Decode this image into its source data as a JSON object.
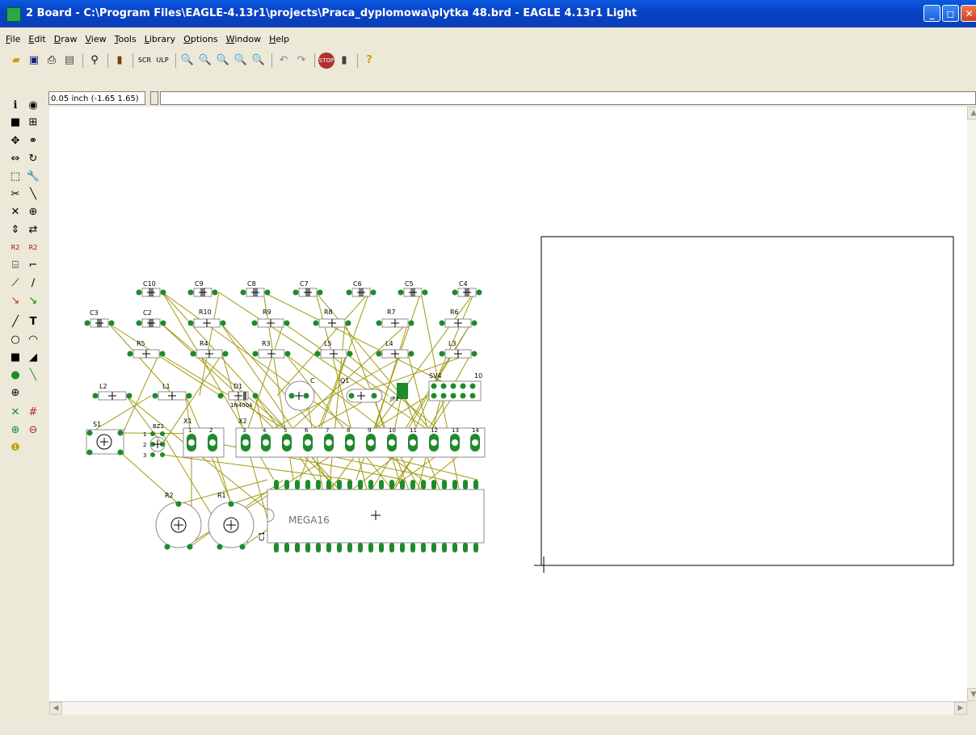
{
  "window": {
    "title": "2 Board - C:\\Program Files\\EAGLE-4.13r1\\projects\\Praca_dyplomowa\\plytka 48.brd - EAGLE 4.13r1 Light",
    "minimize": "_",
    "maximize": "◻",
    "close": "✕"
  },
  "menu": [
    "File",
    "Edit",
    "Draw",
    "View",
    "Tools",
    "Library",
    "Options",
    "Window",
    "Help"
  ],
  "toolbar": {
    "icons": [
      "open-icon",
      "save-icon",
      "print-icon",
      "cam-icon",
      "board-icon",
      "library-icon",
      "script-icon",
      "ulp-icon",
      "zoom-fit-icon",
      "zoom-in-icon",
      "zoom-out-icon",
      "zoom-redraw-icon",
      "zoom-select-icon",
      "undo-icon",
      "redo-icon",
      "stop-icon",
      "go-icon",
      "help-icon"
    ]
  },
  "coordinates": "0.05 inch (-1.65 1.65)",
  "command_value": "",
  "board": {
    "parts": [
      "C10",
      "C9",
      "C8",
      "C7",
      "C6",
      "C5",
      "C4",
      "C3",
      "C2",
      "R10",
      "R9",
      "R8",
      "R7",
      "R6",
      "R5",
      "R4",
      "R3",
      "L5",
      "L4",
      "L3",
      "L2",
      "L1",
      "D1",
      "C",
      "Q1",
      "JP1",
      "SV4",
      "10",
      "S1",
      "BZ1",
      "X1",
      "X2",
      "R2",
      "R1",
      "C1",
      "MEGA16"
    ],
    "d1_value": "1N4004",
    "bz_pins": [
      "1",
      "2",
      "3"
    ],
    "x_pins": [
      "1",
      "2",
      "3",
      "4",
      "5",
      "6",
      "7",
      "8",
      "9",
      "10",
      "11",
      "12",
      "13",
      "14"
    ]
  },
  "colors": {
    "pad": "#1f8a2b",
    "airwire": "#a09a10",
    "outline": "#8c8c8c",
    "titlebar": "#0a4ad6"
  }
}
